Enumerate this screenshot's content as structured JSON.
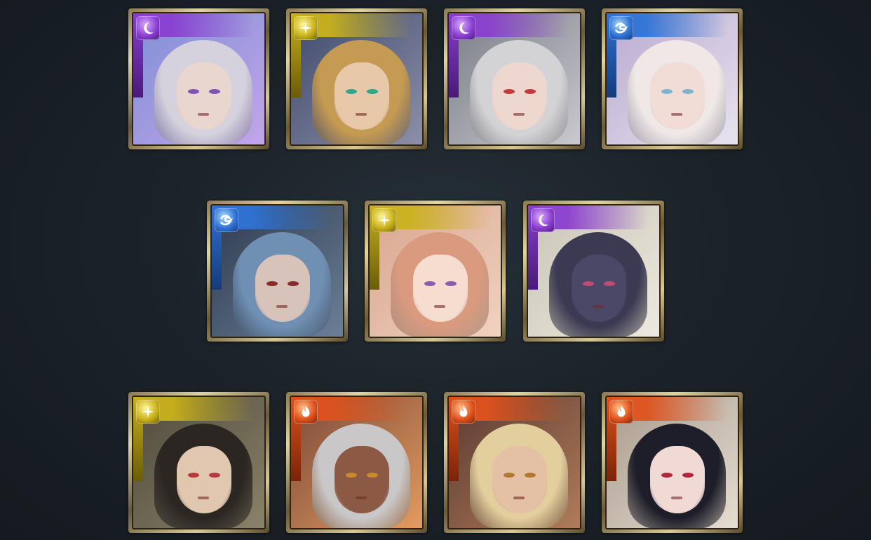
{
  "grid": {
    "rows": [
      [
        {
          "element": "dark",
          "element_icon": "moon-icon",
          "palette": {
            "bg1": "#7f8fd6",
            "bg2": "#c3a5e8",
            "hair": "#d6d2dd",
            "skin": "#e9d6cf",
            "eye": "#7d55b0"
          },
          "portrait_name": "unicorn-horned-white-hair-character"
        },
        {
          "element": "light",
          "element_icon": "sparkle-icon",
          "palette": {
            "bg1": "#3f4a6b",
            "bg2": "#8d8fa8",
            "hair": "#c59a52",
            "skin": "#e7c9aa",
            "eye": "#2fa58b"
          },
          "portrait_name": "blonde-swordsman-character"
        },
        {
          "element": "dark",
          "element_icon": "moon-icon",
          "palette": {
            "bg1": "#7a7d86",
            "bg2": "#c9c9cf",
            "hair": "#d3d3d6",
            "skin": "#eed7cf",
            "eye": "#c33a3a"
          },
          "portrait_name": "silver-black-haired-character"
        },
        {
          "element": "water",
          "element_icon": "wave-icon",
          "palette": {
            "bg1": "#b8a9cf",
            "bg2": "#e9e3ee",
            "hair": "#efe8e6",
            "skin": "#f1ddd6",
            "eye": "#7fb3cf"
          },
          "portrait_name": "pale-haired-veiled-character"
        }
      ],
      [
        {
          "element": "water",
          "element_icon": "wave-icon",
          "palette": {
            "bg1": "#2e3a4f",
            "bg2": "#6b7f96",
            "hair": "#6f8fb3",
            "skin": "#d8c3bb",
            "eye": "#8b2a2a"
          },
          "portrait_name": "blue-haired-fanged-character"
        },
        {
          "element": "light",
          "element_icon": "sparkle-icon",
          "palette": {
            "bg1": "#d9a58f",
            "bg2": "#f0d3c0",
            "hair": "#d99a7f",
            "skin": "#f5ddd0",
            "eye": "#8b5ab2"
          },
          "portrait_name": "pink-haired-smiling-character"
        },
        {
          "element": "dark",
          "element_icon": "moon-icon",
          "palette": {
            "bg1": "#c9c4b6",
            "bg2": "#ede9df",
            "hair": "#3b3a52",
            "skin": "#4a4866",
            "eye": "#c44a70"
          },
          "portrait_name": "dark-armored-beast-character"
        }
      ],
      [
        {
          "element": "light",
          "element_icon": "sparkle-icon",
          "palette": {
            "bg1": "#4f4a3c",
            "bg2": "#8a8268",
            "hair": "#2b2622",
            "skin": "#e1c7b0",
            "eye": "#b73a3a"
          },
          "portrait_name": "headband-dark-haired-character"
        },
        {
          "element": "fire",
          "element_icon": "flame-icon",
          "palette": {
            "bg1": "#7b4a3a",
            "bg2": "#e39b5f",
            "hair": "#c9c7c8",
            "skin": "#8c5a44",
            "eye": "#c98a2a"
          },
          "portrait_name": "silver-haired-tiara-character"
        },
        {
          "element": "fire",
          "element_icon": "flame-icon",
          "palette": {
            "bg1": "#5a3a30",
            "bg2": "#b07b5b",
            "hair": "#e3cf9e",
            "skin": "#e4c0a4",
            "eye": "#b5772e"
          },
          "portrait_name": "blonde-scarred-character"
        },
        {
          "element": "fire",
          "element_icon": "flame-icon",
          "palette": {
            "bg1": "#a89a8c",
            "bg2": "#e6ddd3",
            "hair": "#1e1e2a",
            "skin": "#f1dad5",
            "eye": "#b3263a"
          },
          "portrait_name": "red-hat-elf-character"
        }
      ]
    ]
  },
  "element_colors": {
    "dark": {
      "base": "#8a3fd0",
      "light": "#d9a8ff",
      "dark": "#4a1a7a"
    },
    "light": {
      "base": "#c9b21a",
      "light": "#fff59a",
      "dark": "#6b5c08"
    },
    "water": {
      "base": "#2f73d6",
      "light": "#a8d8ff",
      "dark": "#163b7a"
    },
    "fire": {
      "base": "#e0521c",
      "light": "#ffc08a",
      "dark": "#7a2408"
    }
  }
}
